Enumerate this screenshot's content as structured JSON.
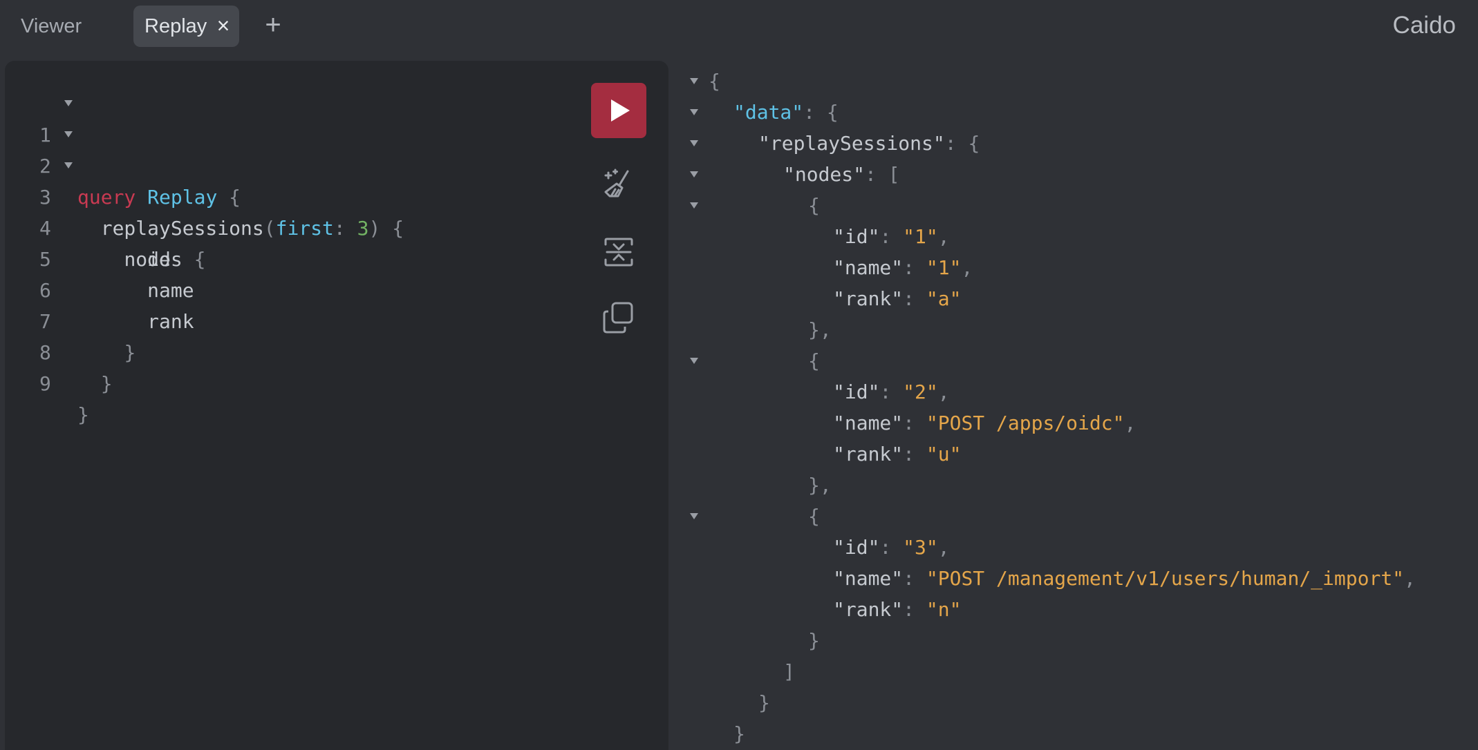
{
  "tabs": {
    "viewer": "Viewer",
    "replay": "Replay",
    "close": "×",
    "add": "+"
  },
  "brand": "Caido",
  "editor": {
    "line_numbers": [
      "1",
      "2",
      "3",
      "4",
      "5",
      "6",
      "7",
      "8",
      "9"
    ],
    "lines": {
      "l1": {
        "kw": "query",
        "name": "Replay",
        "brace": "{"
      },
      "l2": {
        "field": "replaySessions",
        "open": "(",
        "arg": "first",
        "colon": ":",
        "num": "3",
        "close": ")",
        "brace": "{"
      },
      "l3": {
        "field": "nodes",
        "brace": "{"
      },
      "l4": "id",
      "l5": "name",
      "l6": "rank",
      "l7": "}",
      "l8": "}",
      "l9": "}"
    },
    "toolbar_icons": [
      "play-icon",
      "prettify-icon",
      "merge-fragments-icon",
      "copy-icon"
    ]
  },
  "response": {
    "open_brace": "{",
    "data_key": "\"data\"",
    "sessions_key": "\"replaySessions\"",
    "nodes_key": "\"nodes\"",
    "colon": ":",
    "obj_open": "{",
    "arr_open": "[",
    "arr_close": "]",
    "close_brace": "}",
    "close_comma": "},",
    "items": [
      {
        "id_key": "\"id\"",
        "id": "\"1\"",
        "name_key": "\"name\"",
        "name": "\"1\"",
        "rank_key": "\"rank\"",
        "rank": "\"a\""
      },
      {
        "id_key": "\"id\"",
        "id": "\"2\"",
        "name_key": "\"name\"",
        "name": "\"POST /apps/oidc\"",
        "rank_key": "\"rank\"",
        "rank": "\"u\""
      },
      {
        "id_key": "\"id\"",
        "id": "\"3\"",
        "name_key": "\"name\"",
        "name": "\"POST /management/v1/users/human/_import\"",
        "rank_key": "\"rank\"",
        "rank": "\"n\""
      }
    ]
  },
  "colors": {
    "background": "#2f3136",
    "editor_background": "#26282c",
    "run_button": "#a42d40",
    "keyword": "#c93a52",
    "identifier": "#5fc2e6",
    "number": "#73b364",
    "string": "#e5a64a"
  }
}
